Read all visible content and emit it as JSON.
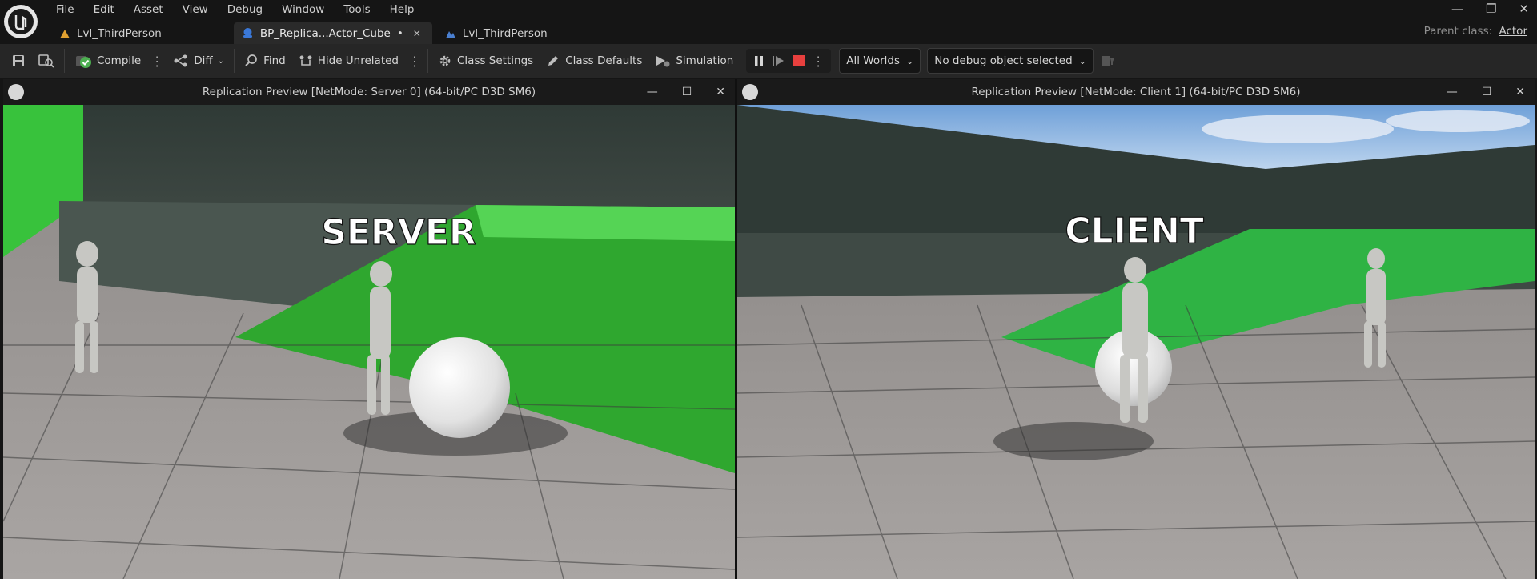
{
  "menu": [
    "File",
    "Edit",
    "Asset",
    "View",
    "Debug",
    "Window",
    "Tools",
    "Help"
  ],
  "tabs": [
    {
      "label": "Lvl_ThirdPerson",
      "active": false
    },
    {
      "label": "BP_Replica...Actor_Cube",
      "active": true,
      "modified_marker": "•"
    },
    {
      "label": "Lvl_ThirdPerson",
      "active": false
    }
  ],
  "parent_class": {
    "label": "Parent class:",
    "value": "Actor"
  },
  "toolbar": {
    "compile": "Compile",
    "diff": "Diff",
    "find": "Find",
    "hide_unrelated": "Hide Unrelated",
    "class_settings": "Class Settings",
    "class_defaults": "Class Defaults",
    "simulation": "Simulation",
    "world_select": "All Worlds",
    "debug_object_select": "No debug object selected"
  },
  "viewports": [
    {
      "title": "Replication Preview [NetMode: Server 0]  (64-bit/PC D3D SM6)",
      "overlay": "SERVER"
    },
    {
      "title": "Replication Preview [NetMode: Client 1]  (64-bit/PC D3D SM6)",
      "overlay": "CLIENT"
    }
  ],
  "colors": {
    "stop": "#e8403e",
    "accent_green": "#2fb344",
    "compile_ok": "#4caf50"
  }
}
